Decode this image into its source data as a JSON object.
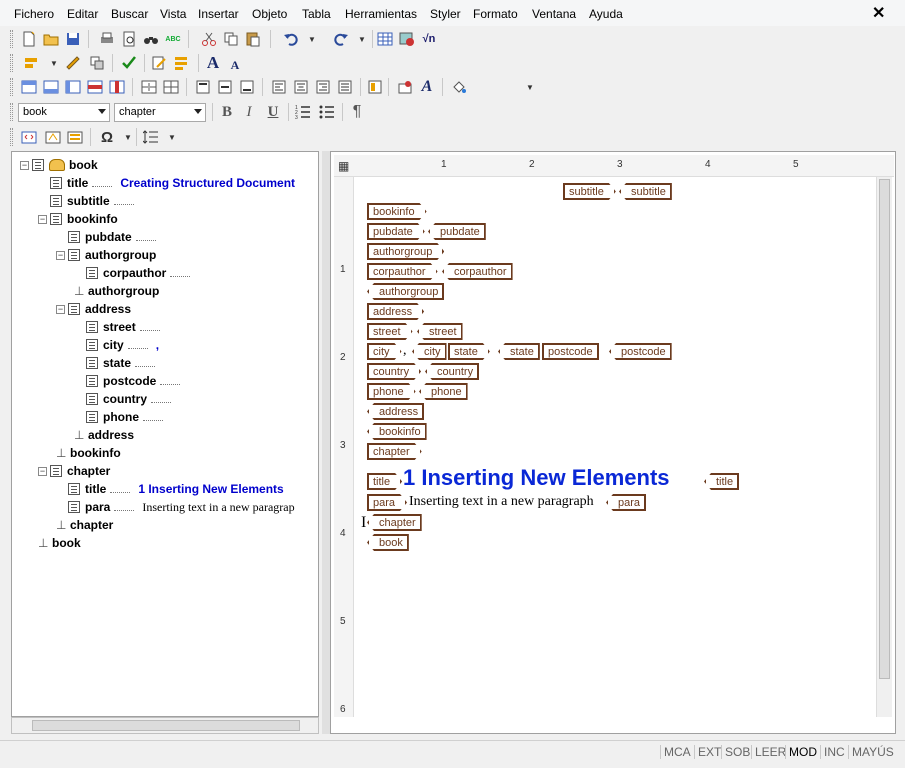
{
  "menu": {
    "items": [
      "Fichero",
      "Editar",
      "Buscar",
      "Vista",
      "Insertar",
      "Objeto",
      "Tabla",
      "Herramientas",
      "Styler",
      "Formato",
      "Ventana",
      "Ayuda"
    ],
    "close_glyph": "✕"
  },
  "toolbar": {
    "style_combo": "book",
    "element_combo": "chapter",
    "bold": "B",
    "italic": "I",
    "underline": "U",
    "pilcrow": "¶",
    "font_large": "A",
    "font_small": "A",
    "omega": "Ω",
    "sqrt": "√n",
    "abc": "ABC"
  },
  "tree": {
    "root": "book",
    "title_name": "title",
    "title_value": "Creating Structured Document",
    "subtitle": "subtitle",
    "bookinfo": "bookinfo",
    "pubdate": "pubdate",
    "authorgroup": "authorgroup",
    "corpauthor": "corpauthor",
    "authorgroup_close": "authorgroup",
    "address": "address",
    "street": "street",
    "city": "city",
    "city_value": ",",
    "state": "state",
    "postcode": "postcode",
    "country": "country",
    "phone": "phone",
    "address_close": "address",
    "bookinfo_close": "bookinfo",
    "chapter": "chapter",
    "chapter_title": "title",
    "chapter_title_value": "1  Inserting New Elements",
    "para": "para",
    "para_value": "Inserting text in a new paragrap",
    "chapter_close": "chapter",
    "book_close": "book"
  },
  "ruler": {
    "top_numbers": [
      "1",
      "2",
      "3",
      "4",
      "5"
    ],
    "left_numbers": [
      "1",
      "2",
      "3",
      "4",
      "5",
      "6"
    ]
  },
  "document": {
    "tags": {
      "subtitle_open": "subtitle",
      "subtitle_close": "subtitle",
      "bookinfo_open": "bookinfo",
      "pubdate_open": "pubdate",
      "pubdate_close": "pubdate",
      "authorgroup_open": "authorgroup",
      "corpauthor_open": "corpauthor",
      "corpauthor_close": "corpauthor",
      "authorgroup_close": "authorgroup",
      "address_open": "address",
      "street_open": "street",
      "street_close": "street",
      "city_open": "city",
      "city_comma": ",",
      "city_close": "city",
      "state_open": "state",
      "state_close": "state",
      "postcode_open": "postcode",
      "postcode_close": "postcode",
      "country_open": "country",
      "country_close": "country",
      "phone_open": "phone",
      "phone_close": "phone",
      "address_close": "address",
      "bookinfo_close": "bookinfo",
      "chapter_open": "chapter",
      "title_open": "title",
      "title_close": "title",
      "para_open": "para",
      "para_close": "para",
      "chapter_close": "chapter",
      "book_close": "book"
    },
    "heading": "1  Inserting New Elements",
    "para_text": "Inserting text in a new paragraph"
  },
  "status": {
    "items": [
      "MCA",
      "EXT",
      "SOB",
      "LEER",
      "MOD",
      "INC",
      "MAYÚS"
    ],
    "active": "MOD"
  },
  "colors": {
    "tag_border": "#6b3a1e",
    "heading": "#0a28d6",
    "tree_value": "#0000cc"
  }
}
